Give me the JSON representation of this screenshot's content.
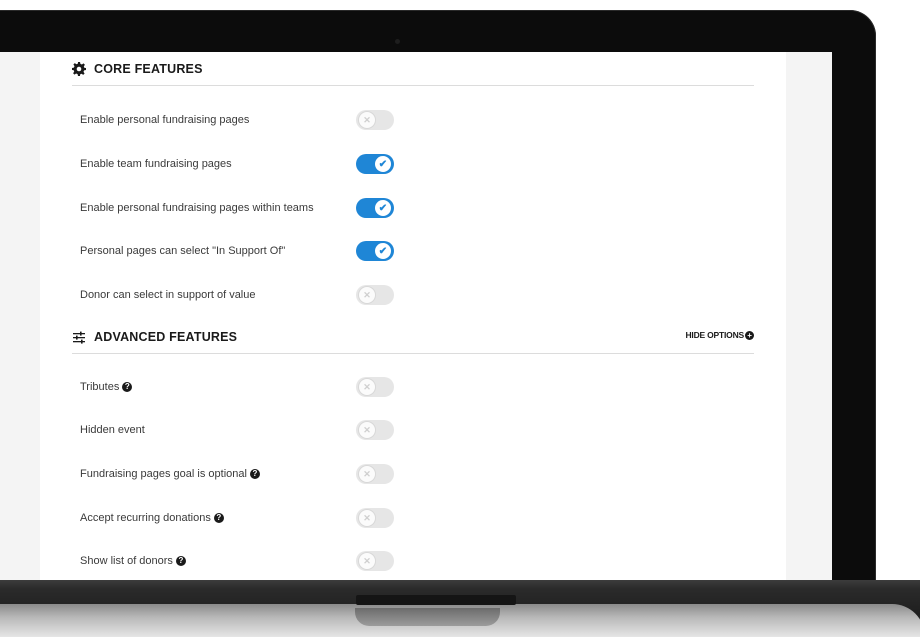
{
  "core": {
    "title": "CORE FEATURES",
    "icon": "gear-icon",
    "items": [
      {
        "label": "Enable personal fundraising pages",
        "enabled": false
      },
      {
        "label": "Enable team fundraising pages",
        "enabled": true
      },
      {
        "label": "Enable personal fundraising pages within teams",
        "enabled": true
      },
      {
        "label": "Personal pages can select \"In Support Of\"",
        "enabled": true
      },
      {
        "label": "Donor can select in support of value",
        "enabled": false
      }
    ]
  },
  "advanced": {
    "title": "ADVANCED FEATURES",
    "icon": "sliders-icon",
    "hide_options_label": "HIDE OPTIONS",
    "items": [
      {
        "label": "Tributes",
        "enabled": false,
        "help": true
      },
      {
        "label": "Hidden event",
        "enabled": false,
        "help": false
      },
      {
        "label": "Fundraising pages goal is optional",
        "enabled": false,
        "help": true
      },
      {
        "label": "Accept recurring donations",
        "enabled": false,
        "help": true
      },
      {
        "label": "Show list of donors",
        "enabled": false,
        "help": true
      }
    ]
  },
  "colors": {
    "toggle_on": "#1f86d6",
    "toggle_off": "#e6e6e6"
  }
}
